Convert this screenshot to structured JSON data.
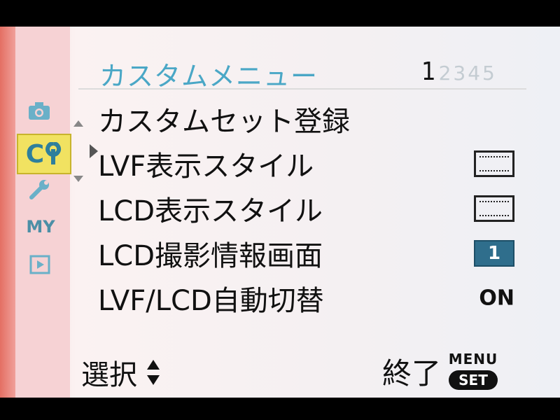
{
  "menu": {
    "title": "カスタムメニュー",
    "pages": {
      "current": "1",
      "others": "2345"
    }
  },
  "sidebar": {
    "tabs": [
      {
        "name": "camera-icon"
      },
      {
        "name": "custom-icon",
        "text": "C",
        "active": true
      },
      {
        "name": "wrench-icon"
      },
      {
        "name": "my-menu",
        "text": "MY"
      },
      {
        "name": "play-icon"
      }
    ]
  },
  "items": [
    {
      "label": "カスタムセット登録",
      "value": ""
    },
    {
      "label": "LVF表示スタイル",
      "value_icon": "display-style-frame-icon"
    },
    {
      "label": "LCD表示スタイル",
      "value_icon": "display-style-frame-icon"
    },
    {
      "label": "LCD撮影情報画面",
      "value": "1"
    },
    {
      "label": "LVF/LCD自動切替",
      "value": "ON"
    }
  ],
  "footer": {
    "select_label": "選択",
    "exit_label": "終了",
    "menu_label": "MENU",
    "set_label": "SET"
  },
  "colors": {
    "title": "#4aa7c6",
    "highlight_tab": "#f1e261",
    "value_box": "#2f6e8c"
  }
}
